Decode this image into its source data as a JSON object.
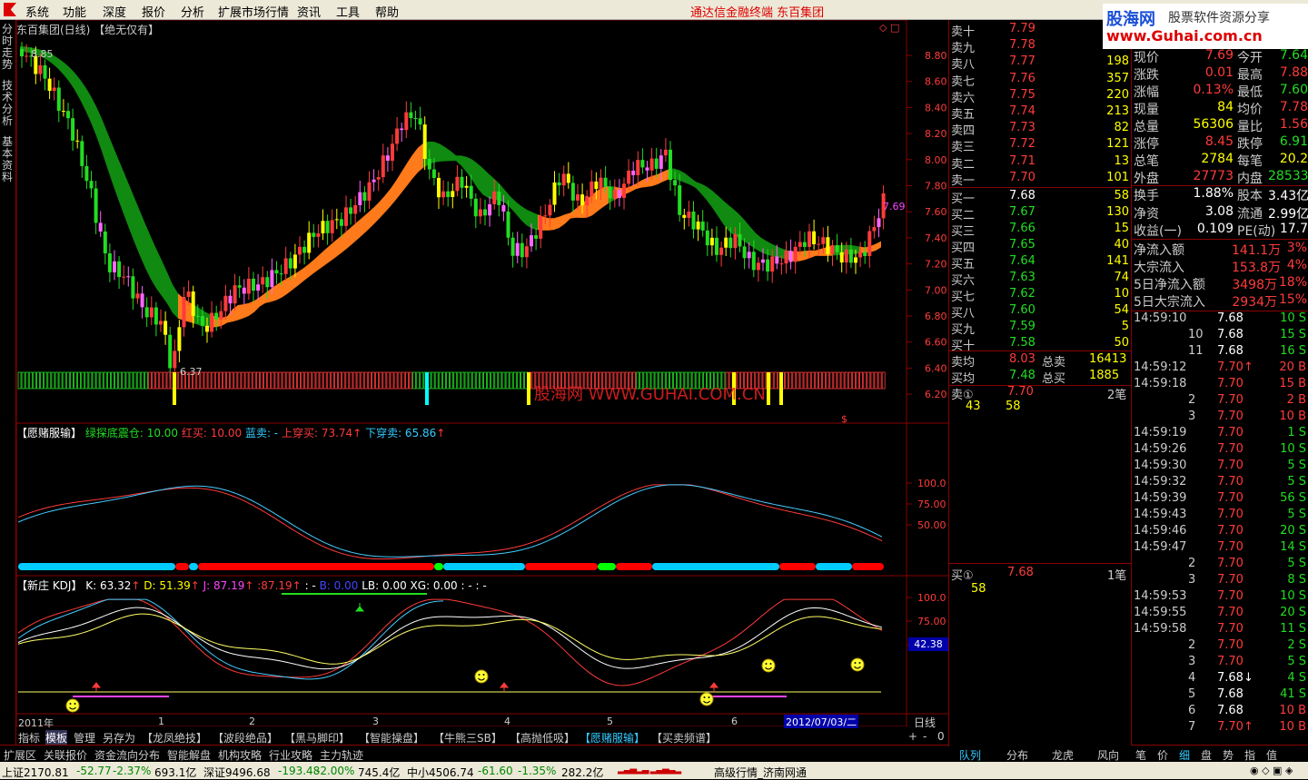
{
  "menu": {
    "items": [
      "系统",
      "功能",
      "深度",
      "报价",
      "分析",
      "扩展市场行情",
      "资讯",
      "工具",
      "帮助"
    ],
    "title": "通达信金融终端   东百集团"
  },
  "brand": {
    "line1": "股海网",
    "line2": "股票软件资源分享",
    "line3": "www.Guhai.com.cn"
  },
  "left_tabs": [
    "分时走势",
    "技术分析",
    "基本资料"
  ],
  "main_chart": {
    "title": "东百集团(日线) 【绝无仅有】",
    "high_label": "8.85",
    "low_label": "6.37",
    "last_label": "7.69",
    "watermark": "股海网 WWW.GUHAI.COM.CN",
    "y_ticks": [
      "8.80",
      "8.60",
      "8.40",
      "8.20",
      "8.00",
      "7.80",
      "7.60",
      "7.40",
      "7.20",
      "7.00",
      "6.80",
      "6.60",
      "6.40",
      "6.20"
    ]
  },
  "ind1": {
    "title": "【愿赌服输】",
    "l1": "绿探底震仓: 10.00",
    "l2": "红买: 10.00",
    "l3": "蓝卖: -",
    "l4": "上穿买: 73.74",
    "l5": "下穿卖: 65.86",
    "y_ticks": [
      "100.0",
      "75.00",
      "50.00"
    ]
  },
  "ind2": {
    "title": "【新庄 KDJ】",
    "k": "K: 63.32",
    "d": "D: 51.39",
    "j": "J: 87.19",
    "x": ":87.19",
    "b": "B: 0.00",
    "lb": "LB: 0.00",
    "xg": "XG: 0.00",
    "y_ticks": [
      "100.0",
      "75.00",
      "50.00"
    ],
    "cursor_val": "42.38"
  },
  "x_axis": {
    "labels": [
      "2011年",
      "1",
      "2",
      "3",
      "4",
      "5",
      "6"
    ],
    "date_box": "2012/07/03/二",
    "period": "日线"
  },
  "bottom_tabs": [
    "指标",
    "模板",
    "管理",
    "另存为",
    "【龙凤绝技】",
    "【波段绝品】",
    "【黑马脚印】",
    "【智能操盘】",
    "【牛熊三SB】",
    "【高抛低吸】",
    "【愿赌服输】",
    "【买卖频谱】"
  ],
  "link_bar": [
    "扩展区",
    "关联报价",
    "资金流向分布",
    "智能解盘",
    "机构攻略",
    "行业攻略",
    "主力轨迹"
  ],
  "status": {
    "sh": "上证2170.81",
    "sh_chg": "-52.77",
    "sh_pct": "-2.37%",
    "sh_amt": "693.1亿",
    "sz": "深证9496.68",
    "sz_chg": "-193.48",
    "sz_pct": "-2.00%",
    "sz_amt": "745.4亿",
    "zx": "中小4506.74",
    "zx_chg": "-61.60",
    "zx_pct": "-1.35%",
    "zx_amt": "282.2亿",
    "net": "高级行情_济南网通"
  },
  "sell": [
    [
      "卖十",
      "7.79",
      "73"
    ],
    [
      "卖九",
      "7.78",
      "39"
    ],
    [
      "卖八",
      "7.77",
      "198"
    ],
    [
      "卖七",
      "7.76",
      "357"
    ],
    [
      "卖六",
      "7.75",
      "220"
    ],
    [
      "卖五",
      "7.74",
      "213"
    ],
    [
      "卖四",
      "7.73",
      "82"
    ],
    [
      "卖三",
      "7.72",
      "121"
    ],
    [
      "卖二",
      "7.71",
      "13"
    ],
    [
      "卖一",
      "7.70",
      "101"
    ]
  ],
  "buy": [
    [
      "买一",
      "7.68",
      "58"
    ],
    [
      "买二",
      "7.67",
      "130"
    ],
    [
      "买三",
      "7.66",
      "15"
    ],
    [
      "买四",
      "7.65",
      "40"
    ],
    [
      "买五",
      "7.64",
      "141"
    ],
    [
      "买六",
      "7.63",
      "74"
    ],
    [
      "买七",
      "7.62",
      "10"
    ],
    [
      "买八",
      "7.60",
      "54"
    ],
    [
      "买九",
      "7.59",
      "5"
    ],
    [
      "买十",
      "7.58",
      "50"
    ]
  ],
  "avg": {
    "sell_avg_l": "卖均",
    "sell_avg": "8.03",
    "total_sell_l": "总卖",
    "total_sell": "16413",
    "buy_avg_l": "买均",
    "buy_avg": "7.48",
    "total_buy_l": "总买",
    "total_buy": "1885"
  },
  "queue": {
    "sell_l": "卖①",
    "sell_p": "7.70",
    "sell_n": "2笔",
    "sell_q1": "43",
    "sell_q2": "58",
    "buy_l": "买①",
    "buy_p": "7.68",
    "buy_n": "1笔",
    "buy_q1": "58"
  },
  "info": [
    [
      "现价",
      "7.69",
      "今开",
      "7.64"
    ],
    [
      "涨跌",
      "0.01",
      "最高",
      "7.88"
    ],
    [
      "涨幅",
      "0.13%",
      "最低",
      "7.60"
    ],
    [
      "现量",
      "84",
      "均价",
      "7.78"
    ],
    [
      "总量",
      "56306",
      "量比",
      "1.56"
    ],
    [
      "涨停",
      "8.45",
      "跌停",
      "6.91"
    ],
    [
      "总笔",
      "2784",
      "每笔",
      "20.2"
    ],
    [
      "外盘",
      "27773",
      "内盘",
      "28533"
    ],
    [
      "换手",
      "1.88%",
      "股本",
      "3.43亿"
    ],
    [
      "净资",
      "3.08",
      "流通",
      "2.99亿"
    ],
    [
      "收益(一)",
      "0.109",
      "PE(动)",
      "17.7"
    ]
  ],
  "flow": [
    [
      "净流入额",
      "141.1万",
      "3%"
    ],
    [
      "大宗流入",
      "153.8万",
      "4%"
    ],
    [
      "5日净流入额",
      "3498万",
      "18%"
    ],
    [
      "5日大宗流入",
      "2934万",
      "15%"
    ]
  ],
  "ticks": [
    [
      "14:59:10",
      "7.68",
      "10 S"
    ],
    [
      "10",
      "7.68",
      "15 S"
    ],
    [
      "11",
      "7.68",
      "16 S"
    ],
    [
      "14:59:12",
      "7.70↑",
      "20 B"
    ],
    [
      "14:59:18",
      "7.70",
      "15 B"
    ],
    [
      "2",
      "7.70",
      "2 B"
    ],
    [
      "3",
      "7.70",
      "10 B"
    ],
    [
      "14:59:19",
      "7.70",
      "1 S"
    ],
    [
      "14:59:26",
      "7.70",
      "10 S"
    ],
    [
      "14:59:30",
      "7.70",
      "5 S"
    ],
    [
      "14:59:32",
      "7.70",
      "5 S"
    ],
    [
      "14:59:39",
      "7.70",
      "56 S"
    ],
    [
      "14:59:43",
      "7.70",
      "5 S"
    ],
    [
      "14:59:46",
      "7.70",
      "20 S"
    ],
    [
      "14:59:47",
      "7.70",
      "14 S"
    ],
    [
      "2",
      "7.70",
      "5 S"
    ],
    [
      "3",
      "7.70",
      "8 S"
    ],
    [
      "14:59:53",
      "7.70",
      "10 S"
    ],
    [
      "14:59:55",
      "7.70",
      "20 S"
    ],
    [
      "14:59:58",
      "7.70",
      "11 S"
    ],
    [
      "2",
      "7.70",
      "2 S"
    ],
    [
      "3",
      "7.70",
      "5 S"
    ],
    [
      "4",
      "7.68↓",
      "4 S"
    ],
    [
      "5",
      "7.68",
      "41 S"
    ],
    [
      "6",
      "7.68",
      "10 B"
    ],
    [
      "7",
      "7.70↑",
      "10 B"
    ]
  ],
  "right_tabs": [
    "队列",
    "分布",
    "龙虎",
    "风向",
    "笔",
    "价",
    "细",
    "盘",
    "势",
    "指",
    "值"
  ]
}
